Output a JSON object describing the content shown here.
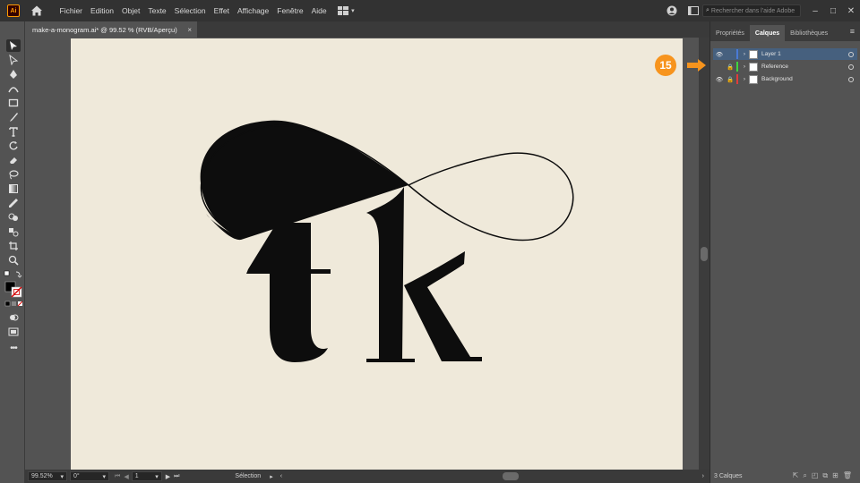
{
  "app": {
    "logo": "Ai",
    "home_icon": "home-icon"
  },
  "menu": [
    "Fichier",
    "Edition",
    "Objet",
    "Texte",
    "Sélection",
    "Effet",
    "Affichage",
    "Fenêtre",
    "Aide"
  ],
  "search": {
    "placeholder": "Rechercher dans l'aide Adobe"
  },
  "document": {
    "tab_title": "make-a-monogram.ai* @ 99.52 % (RVB/Aperçu)",
    "close_glyph": "×"
  },
  "artwork": {
    "letters": "tk"
  },
  "status": {
    "zoom": "99.52%",
    "rotation": "0°",
    "artboard_number": "1",
    "tool_name": "Sélection"
  },
  "panel": {
    "tabs": [
      "Propriétés",
      "Calques",
      "Bibliothèques"
    ],
    "active_tab": "Calques",
    "layers": [
      {
        "name": "Layer 1",
        "color": "#4a7bd6",
        "visible": true,
        "locked": false,
        "selected": true
      },
      {
        "name": "Reference",
        "color": "#3fd53f",
        "visible": false,
        "locked": true,
        "selected": false
      },
      {
        "name": "Background",
        "color": "#e03c3c",
        "visible": true,
        "locked": true,
        "selected": false
      }
    ],
    "layer_count": "3 Calques"
  },
  "callout": {
    "step": "15",
    "color": "#f7941d"
  },
  "colors": {
    "artboard": "#efe9da",
    "accent": "#f7941d",
    "selection": "#46607e"
  }
}
